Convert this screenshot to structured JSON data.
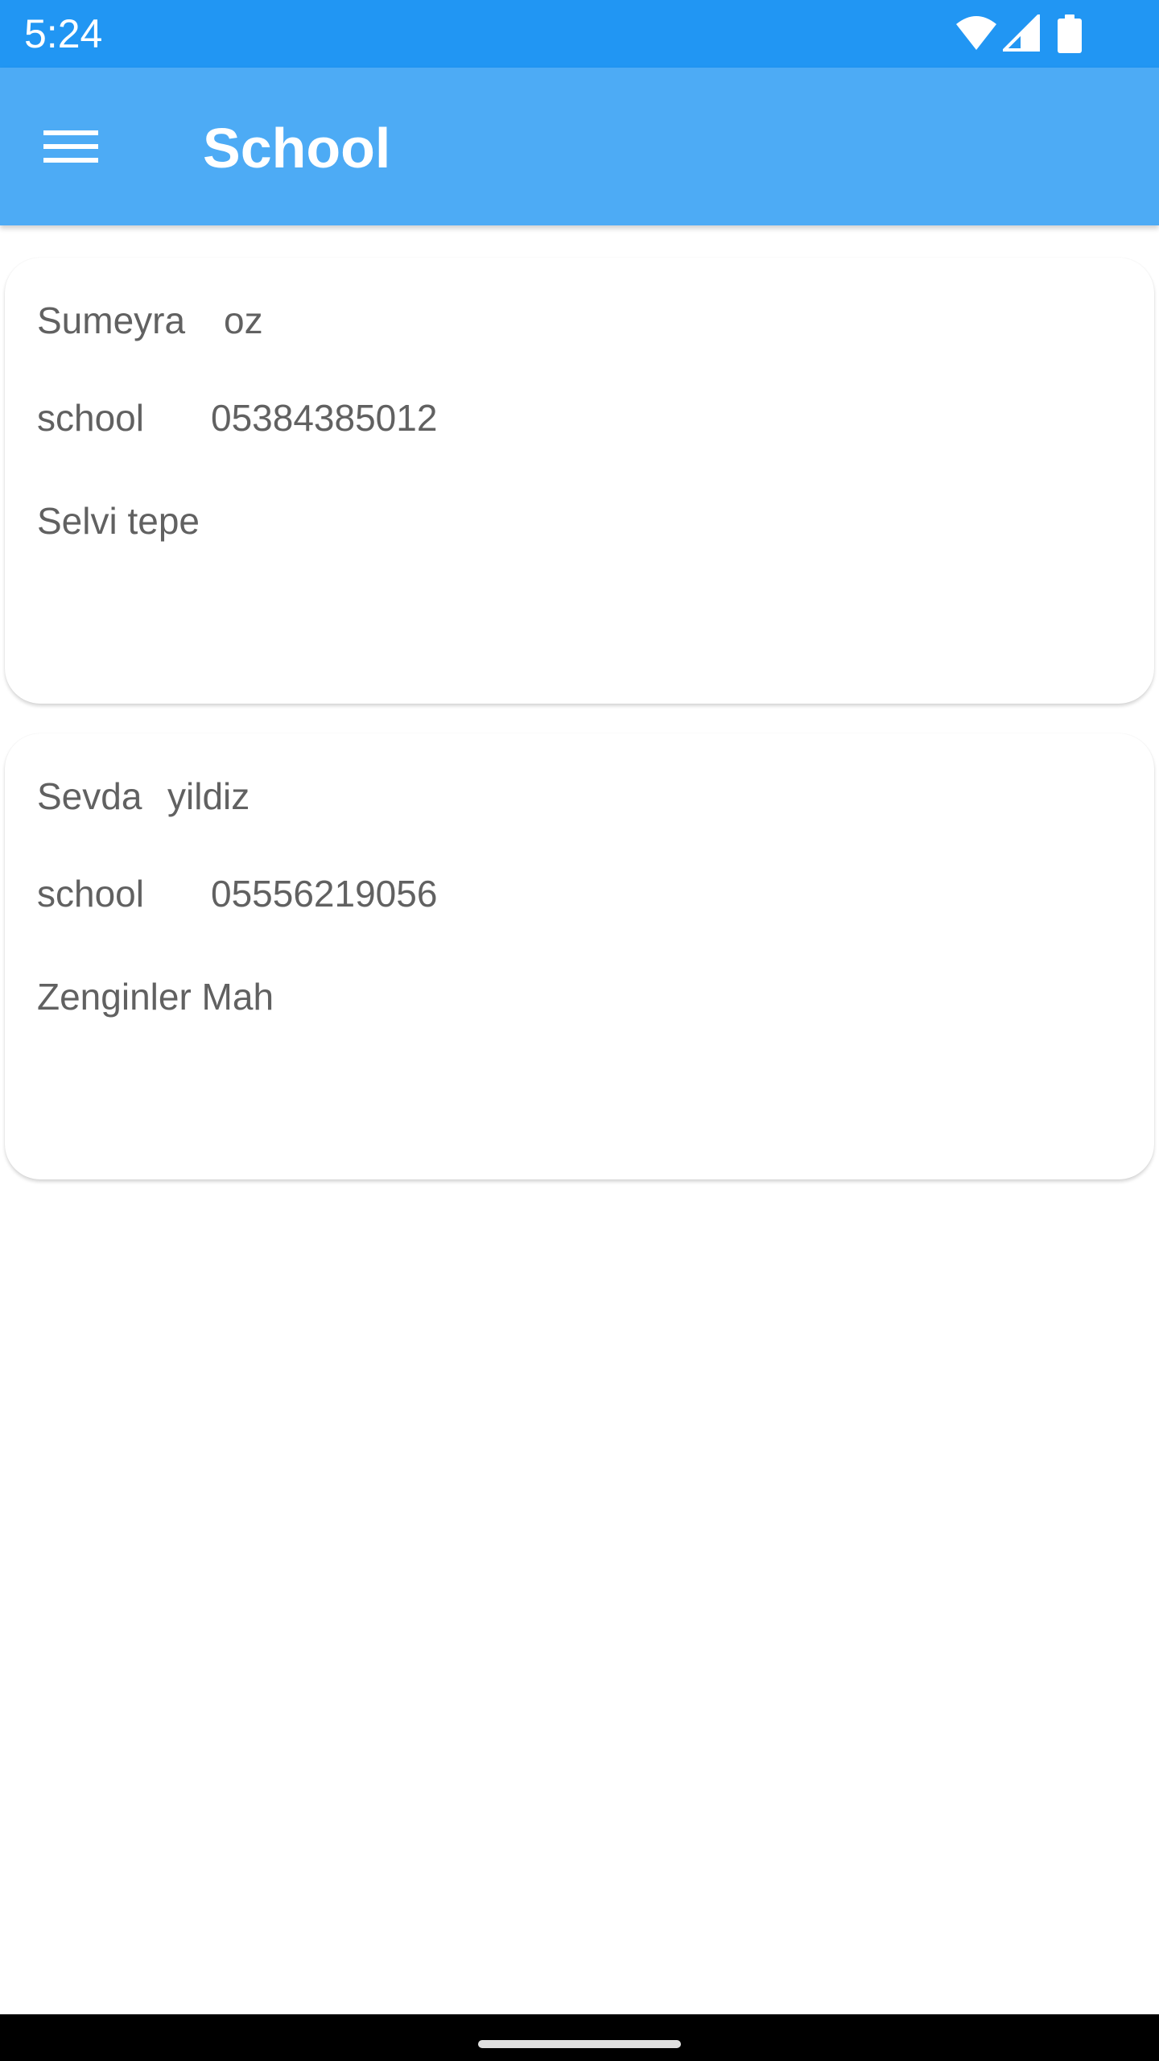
{
  "status_bar": {
    "time": "5:24",
    "icons": [
      "wifi-icon",
      "cellular-signal-icon",
      "battery-icon"
    ],
    "background_color": "#2196f3"
  },
  "app_bar": {
    "title": "School",
    "menu_icon": "hamburger-menu-icon",
    "background_color": "#4dabf5"
  },
  "contacts": [
    {
      "first_name": "Sumeyra",
      "last_name": "oz",
      "role": "school",
      "phone": "05384385012",
      "address": "Selvi tepe"
    },
    {
      "first_name": "Sevda",
      "last_name": "yildiz",
      "role": "school",
      "phone": "05556219056",
      "address": "Zenginler Mah"
    }
  ]
}
